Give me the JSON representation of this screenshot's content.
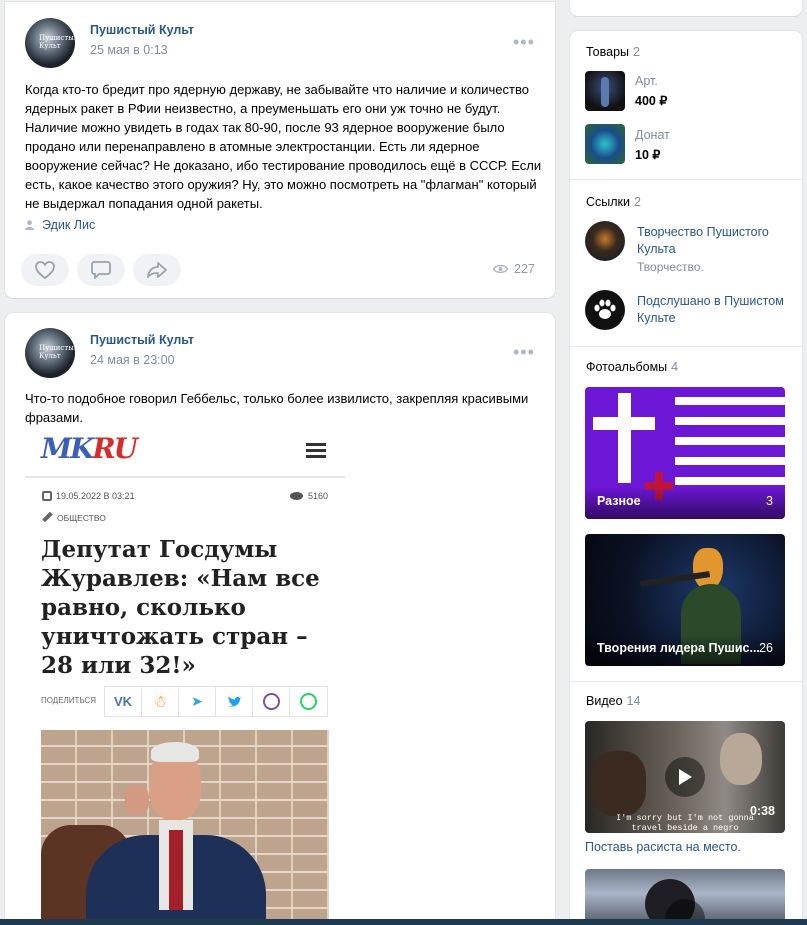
{
  "post1": {
    "author": "Пушистый Культ",
    "date": "25 мая в 0:13",
    "avatar_text": "Пушистый Культ",
    "text": "Когда кто-то бредит про ядерную державу, не забывайте что наличие и количество ядерных ракет в РФии неизвестно, а преуменьшать его они уж точно не будут. Наличие можно увидеть в годах так 80-90, после 93 ядерное вооружение было продано или перенаправлено в атомные электростанции. Есть ли ядерное вооружение сейчас? Не доказано, ибо тестирование проводилось ещё в СССР. Если есть, какое качество этого оружия? Ну, это можно посмотреть на \"флагман\" который не выдержал попадания одной ракеты.",
    "signer": "Эдик Лис",
    "views": "227"
  },
  "post2": {
    "author": "Пушистый Культ",
    "date": "24 мая в 23:00",
    "avatar_text": "Пушистый Культ",
    "text": "Что-то подобное говорил Геббельс, только более извилисто, закрепляя красивыми фразами.",
    "article": {
      "logo": "MK RU",
      "date": "19.05.2022 В 03:21",
      "views": "5160",
      "section": "ОБЩЕСТВО",
      "headline": "Депутат Госдумы Журавлев: «Нам все равно, сколько уничтожать стран – 28 или 32!»",
      "share_label": "ПОДЕЛИТЬСЯ"
    }
  },
  "sidebar": {
    "goods": {
      "title": "Товары",
      "count": "2",
      "items": [
        {
          "name": "Арт.",
          "price": "400 ₽"
        },
        {
          "name": "Донат",
          "price": "10 ₽"
        }
      ]
    },
    "links": {
      "title": "Ссылки",
      "count": "2",
      "items": [
        {
          "name": "Творчество Пушистого Культа",
          "desc": "Творчество."
        },
        {
          "name": "Подслушано в Пушистом Культе",
          "desc": ""
        }
      ]
    },
    "albums": {
      "title": "Фотоальбомы",
      "count": "4",
      "items": [
        {
          "name": "Разное",
          "count": "3"
        },
        {
          "name": "Творения лидера Пушис...",
          "count": "26"
        }
      ]
    },
    "videos": {
      "title": "Видео",
      "count": "14",
      "items": [
        {
          "duration": "0:38",
          "subtitle": "I'm sorry but I'm not gonna travel beside a negro",
          "title": "Поставь расиста на место."
        }
      ]
    }
  },
  "colors": {
    "link": "#2a5885",
    "secondary": "#818c99",
    "background": "#edeef0"
  }
}
